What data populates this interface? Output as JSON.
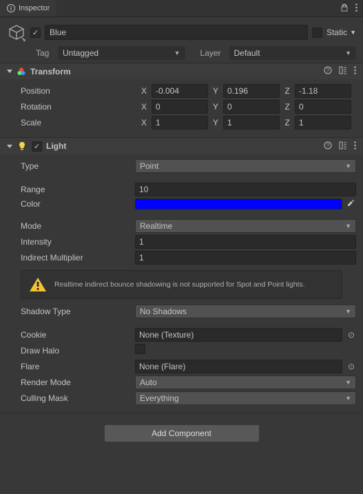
{
  "tab": {
    "title": "Inspector"
  },
  "gameobject": {
    "active": true,
    "name": "Blue",
    "static_label": "Static",
    "tag_label": "Tag",
    "tag": "Untagged",
    "layer_label": "Layer",
    "layer": "Default"
  },
  "transform": {
    "title": "Transform",
    "position_label": "Position",
    "rotation_label": "Rotation",
    "scale_label": "Scale",
    "axes": {
      "x": "X",
      "y": "Y",
      "z": "Z"
    },
    "position": {
      "x": "-0.004",
      "y": "0.196",
      "z": "-1.18"
    },
    "rotation": {
      "x": "0",
      "y": "0",
      "z": "0"
    },
    "scale": {
      "x": "1",
      "y": "1",
      "z": "1"
    }
  },
  "light": {
    "title": "Light",
    "type_label": "Type",
    "type": "Point",
    "range_label": "Range",
    "range": "10",
    "color_label": "Color",
    "color": "#0000ff",
    "mode_label": "Mode",
    "mode": "Realtime",
    "intensity_label": "Intensity",
    "intensity": "1",
    "indirect_label": "Indirect Multiplier",
    "indirect": "1",
    "warning": "Realtime indirect bounce shadowing is not supported for Spot and Point lights.",
    "shadow_label": "Shadow Type",
    "shadow": "No Shadows",
    "cookie_label": "Cookie",
    "cookie": "None (Texture)",
    "halo_label": "Draw Halo",
    "halo": false,
    "flare_label": "Flare",
    "flare": "None (Flare)",
    "render_label": "Render Mode",
    "render": "Auto",
    "culling_label": "Culling Mask",
    "culling": "Everything"
  },
  "add_component_label": "Add Component"
}
